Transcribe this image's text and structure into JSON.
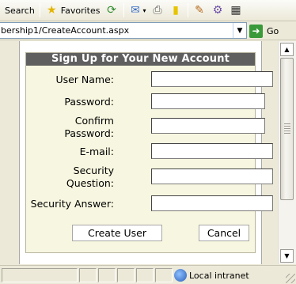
{
  "toolbar": {
    "search_label": "Search",
    "favorites_label": "Favorites",
    "icons": [
      "search-icon",
      "favorites-star-icon",
      "media-icon",
      "mail-icon",
      "print-icon",
      "edit-icon",
      "messenger-icon",
      "research-icon",
      "dial-icon"
    ]
  },
  "address": {
    "url": "bership1/CreateAccount.aspx",
    "go_label": "Go"
  },
  "form": {
    "title": "Sign Up for Your New Account",
    "fields": {
      "username_label": "User Name:",
      "password_label": "Password:",
      "confirm_label_1": "Confirm",
      "confirm_label_2": "Password:",
      "email_label": "E-mail:",
      "question_label_1": "Security",
      "question_label_2": "Question:",
      "answer_label": "Security Answer:"
    },
    "values": {
      "username": "",
      "password": "",
      "confirm": "",
      "email": "",
      "question": "",
      "answer": ""
    },
    "create_label": "Create User",
    "cancel_label": "Cancel"
  },
  "status": {
    "zone": "Local intranet"
  },
  "colors": {
    "title_bar": "#5f5f5f",
    "form_background": "#f7f6e0",
    "go_button": "#3a9a3a"
  }
}
